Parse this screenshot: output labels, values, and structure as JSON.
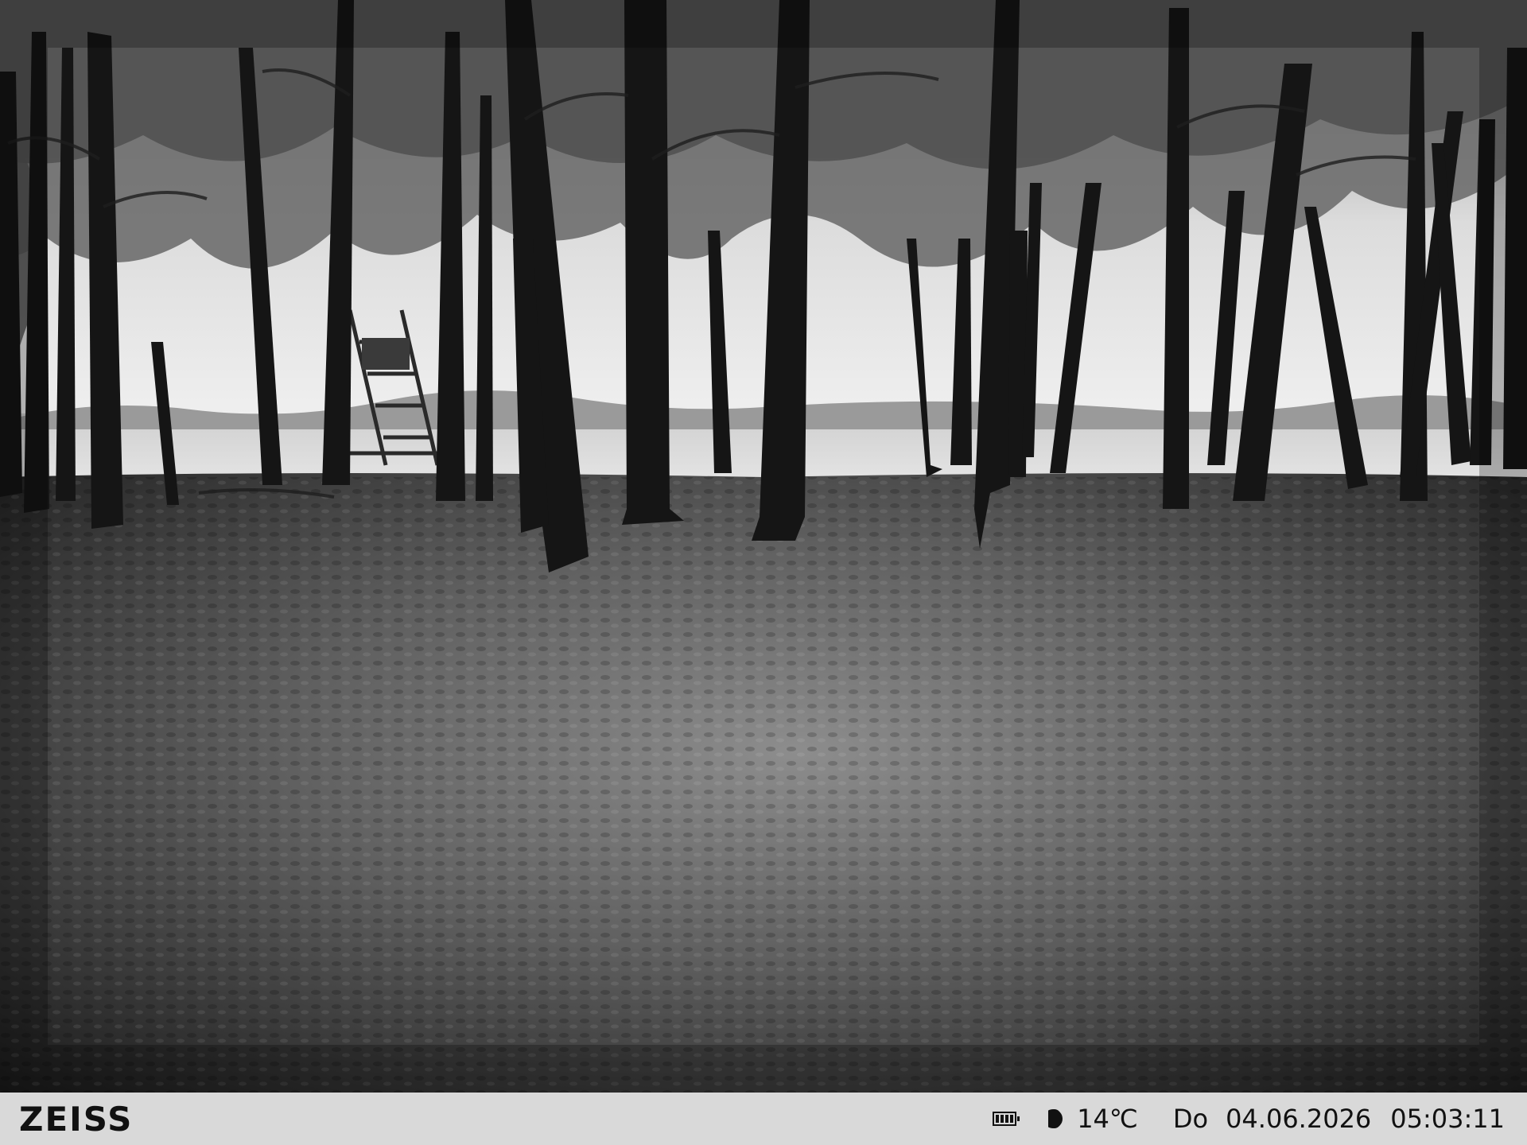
{
  "camera": {
    "brand": "ZEISS",
    "battery_icon": "battery-full-icon",
    "moon_icon": "moon-phase-icon",
    "temperature": "14℃",
    "weekday": "Do",
    "date": "04.06.2026",
    "time": "05:03:11"
  }
}
